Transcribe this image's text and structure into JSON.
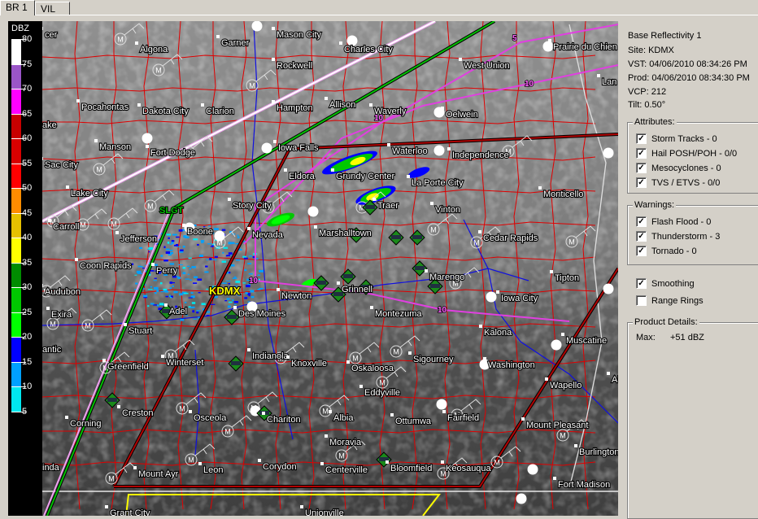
{
  "tabs": [
    {
      "label": "BR 1",
      "active": true
    },
    {
      "label": "VIL",
      "active": false
    }
  ],
  "legend": {
    "title": "DBZ",
    "labels": [
      "80",
      "75",
      "70",
      "65",
      "60",
      "55",
      "50",
      "45",
      "40",
      "35",
      "30",
      "25",
      "20",
      "15",
      "10",
      "5"
    ],
    "colors": [
      "#ffffff",
      "#9a55c8",
      "#ff00ff",
      "#c80000",
      "#d80000",
      "#ff0000",
      "#ff8c00",
      "#e6c000",
      "#ffff00",
      "#008c00",
      "#00c800",
      "#00ff00",
      "#0000ff",
      "#00a0ff",
      "#00e8f0"
    ]
  },
  "product": {
    "name": "Base Reflectivity 1",
    "site": "Site:  KDMX",
    "vst": "VST: 04/06/2010  08:34:26 PM",
    "prod": "Prod: 04/06/2010  08:34:30 PM",
    "vcp": "VCP: 212",
    "tilt": "Tilt:   0.50°"
  },
  "attributes": {
    "title": "Attributes:",
    "items": [
      {
        "label": "Storm Tracks - 0",
        "checked": true
      },
      {
        "label": "Hail POSH/POH - 0/0",
        "checked": true
      },
      {
        "label": "Mesocyclones - 0",
        "checked": true
      },
      {
        "label": "TVS / ETVS - 0/0",
        "checked": true
      }
    ]
  },
  "warnings": {
    "title": "Warnings:",
    "items": [
      {
        "label": "Flash Flood - 0",
        "checked": true
      },
      {
        "label": "Thunderstorm - 3",
        "checked": true
      },
      {
        "label": "Tornado - 0",
        "checked": true
      }
    ]
  },
  "options": [
    {
      "label": "Smoothing",
      "checked": true
    },
    {
      "label": "Range Rings",
      "checked": false
    }
  ],
  "details": {
    "title": "Product Details:",
    "max_label": "Max:",
    "max_value": "+51 dBZ"
  },
  "map": {
    "radar_site": "KDMX",
    "outlook_label": "SLGT",
    "contour_labels": [
      "5",
      "10",
      "10",
      "10",
      "10"
    ],
    "cities": [
      "cer",
      "Algona",
      "Garner",
      "Mason City",
      "Charles City",
      "West Union",
      "Prairie du Chien",
      "Rockwell",
      "Pocahontas",
      "Dakota City",
      "Clarion",
      "Hampton",
      "Allison",
      "Waverly",
      "Oelwein",
      "ake",
      "Manson",
      "Fort Dodge",
      "Iowa Falls",
      "Waterloo",
      "Independence",
      "Sac City",
      "Eldora",
      "Grundy Center",
      "La Porte City",
      "Monticello",
      "Lake City",
      "Traer",
      "Vinton",
      "Story City",
      "Boone",
      "Nevada",
      "Marshalltown",
      "Cedar Rapids",
      "Carroll",
      "Jefferson",
      "Coon Rapids",
      "Perry",
      "Tipton",
      "Audubon",
      "Marengo",
      "Newton",
      "Grinnell",
      "Montezuma",
      "Iowa City",
      "Exira",
      "Adel",
      "Des Moines",
      "Stuart",
      "Kalona",
      "Muscatine",
      "antic",
      "Greenfield",
      "Winterset",
      "Indianola",
      "Knoxville",
      "Oskaloosa",
      "Sigourney",
      "Washington",
      "Wapello",
      "Eddyville",
      "Creston",
      "Corning",
      "Osceola",
      "Chariton",
      "Albia",
      "Ottumwa",
      "Fairfield",
      "Mount Pleasant",
      "Burlington",
      "Moravia",
      "Centerville",
      "Bloomfield",
      "Keosauqua",
      "Corydon",
      "Leon",
      "Mount Ayr",
      "Fort Madison",
      "inda",
      "Grant City",
      "Unionville",
      "Lan",
      "Ale"
    ]
  }
}
